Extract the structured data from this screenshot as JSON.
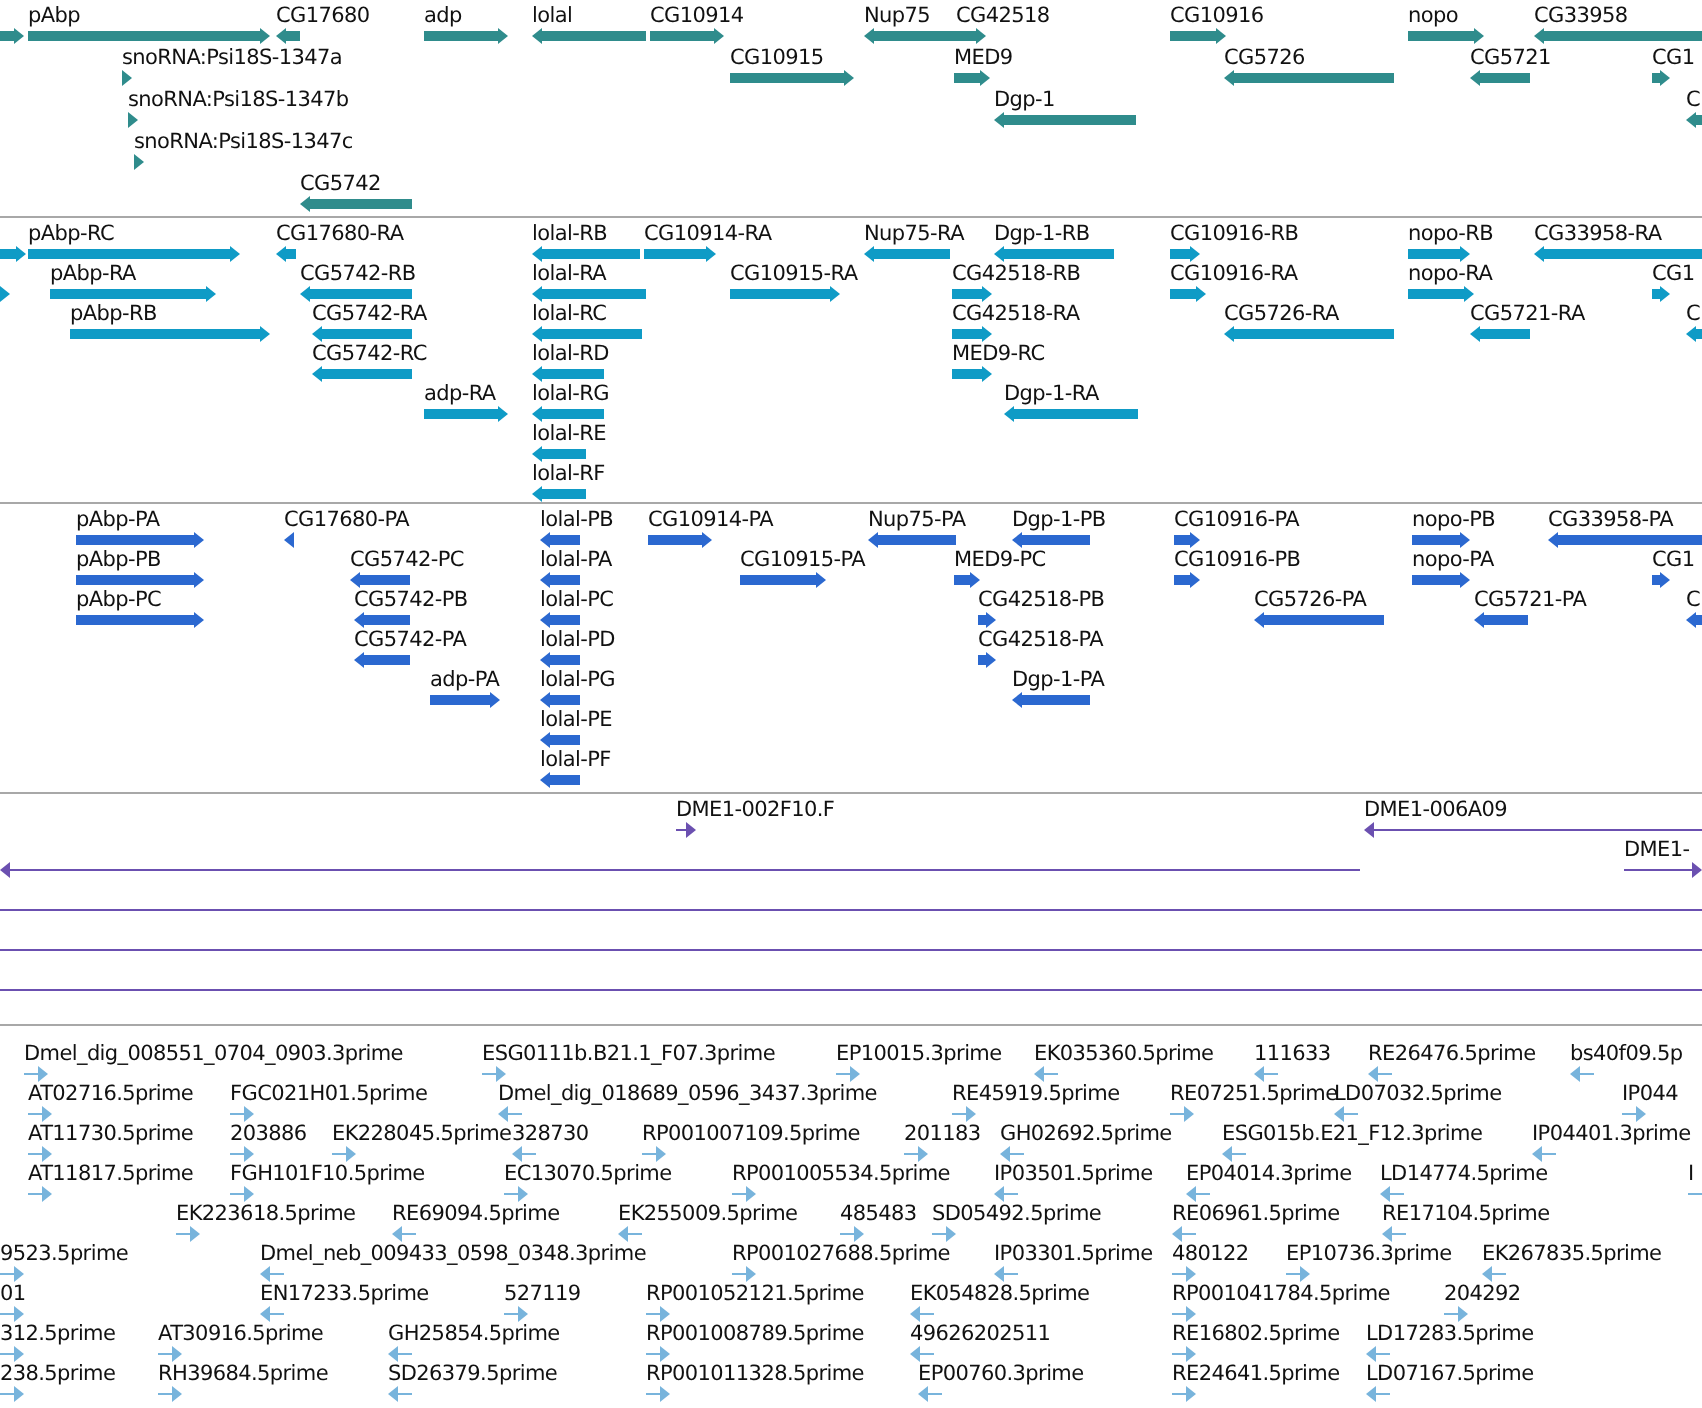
{
  "tracks": [
    {
      "kind": "gene",
      "color": "#2f8c8c",
      "rows": [
        {
          "features": [
            {
              "reverse": false
            },
            {
              "label": "pAbp",
              "reverse": false
            },
            {
              "label": "CG17680",
              "reverse": true
            },
            {
              "label": "adp",
              "reverse": false
            },
            {
              "label": "lolal",
              "reverse": true
            },
            {
              "label": "CG10914",
              "reverse": false
            },
            {
              "label": "Nup75",
              "reverse": true
            },
            {
              "label": "CG42518",
              "reverse": false
            },
            {
              "label": "CG10916",
              "reverse": false
            },
            {
              "label": "nopo",
              "reverse": false
            },
            {
              "label": "CG33958",
              "reverse": true
            }
          ]
        },
        {
          "features": [
            {
              "label": "snoRNA:Psi18S-1347a",
              "reverse": false
            },
            {
              "label": "CG10915",
              "reverse": false
            },
            {
              "label": "MED9",
              "reverse": false
            },
            {
              "label": "CG5726",
              "reverse": true
            },
            {
              "label": "CG5721",
              "reverse": true
            },
            {
              "label": "CG1",
              "reverse": false
            }
          ]
        },
        {
          "features": [
            {
              "label": "snoRNA:Psi18S-1347b",
              "reverse": false
            },
            {
              "label": "Dgp-1",
              "reverse": true
            },
            {
              "label": "C",
              "reverse": true
            }
          ]
        },
        {
          "features": [
            {
              "label": "snoRNA:Psi18S-1347c",
              "reverse": false
            }
          ]
        },
        {
          "features": [
            {
              "label": "CG5742",
              "reverse": true
            }
          ]
        }
      ]
    },
    {
      "kind": "gene",
      "color": "#0f9bc6",
      "rows": [
        {
          "features": [
            {
              "reverse": false
            },
            {
              "label": "pAbp-RC",
              "reverse": false
            },
            {
              "label": "CG17680-RA",
              "reverse": true
            },
            {
              "label": "lolal-RB",
              "reverse": true
            },
            {
              "label": "CG10914-RA",
              "reverse": false
            },
            {
              "label": "Nup75-RA",
              "reverse": true
            },
            {
              "label": "Dgp-1-RB",
              "reverse": true
            },
            {
              "label": "CG10916-RB",
              "reverse": false
            },
            {
              "label": "nopo-RB",
              "reverse": false
            },
            {
              "label": "CG33958-RA",
              "reverse": true
            }
          ]
        },
        {
          "features": [
            {
              "reverse": false
            },
            {
              "label": "pAbp-RA",
              "reverse": false
            },
            {
              "label": "CG5742-RB",
              "reverse": true
            },
            {
              "label": "lolal-RA",
              "reverse": true
            },
            {
              "label": "CG10915-RA",
              "reverse": false
            },
            {
              "label": "CG42518-RB",
              "reverse": false
            },
            {
              "label": "CG10916-RA",
              "reverse": false
            },
            {
              "label": "nopo-RA",
              "reverse": false
            },
            {
              "label": "CG1",
              "reverse": false
            }
          ]
        },
        {
          "features": [
            {
              "label": "pAbp-RB",
              "reverse": false
            },
            {
              "label": "CG5742-RA",
              "reverse": true
            },
            {
              "label": "lolal-RC",
              "reverse": true
            },
            {
              "label": "CG42518-RA",
              "reverse": false
            },
            {
              "label": "CG5726-RA",
              "reverse": true
            },
            {
              "label": "CG5721-RA",
              "reverse": true
            },
            {
              "label": "C",
              "reverse": true
            }
          ]
        },
        {
          "features": [
            {
              "label": "CG5742-RC",
              "reverse": true
            },
            {
              "label": "lolal-RD",
              "reverse": true
            },
            {
              "label": "MED9-RC",
              "reverse": false
            }
          ]
        },
        {
          "features": [
            {
              "label": "adp-RA",
              "reverse": false
            },
            {
              "label": "lolal-RG",
              "reverse": true
            },
            {
              "label": "Dgp-1-RA",
              "reverse": true
            }
          ]
        },
        {
          "features": [
            {
              "label": "lolal-RE",
              "reverse": true
            }
          ]
        },
        {
          "features": [
            {
              "label": "lolal-RF",
              "reverse": true
            }
          ]
        }
      ]
    },
    {
      "kind": "gene",
      "color": "#2b68d0",
      "rows": [
        {
          "features": [
            {
              "label": "pAbp-PA",
              "reverse": false
            },
            {
              "label": "CG17680-PA",
              "reverse": true
            },
            {
              "label": "lolal-PB",
              "reverse": true
            },
            {
              "label": "CG10914-PA",
              "reverse": false
            },
            {
              "label": "Nup75-PA",
              "reverse": true
            },
            {
              "label": "Dgp-1-PB",
              "reverse": true
            },
            {
              "label": "CG10916-PA",
              "reverse": false
            },
            {
              "label": "nopo-PB",
              "reverse": false
            },
            {
              "label": "CG33958-PA",
              "reverse": true
            }
          ]
        },
        {
          "features": [
            {
              "label": "pAbp-PB",
              "reverse": false
            },
            {
              "label": "CG5742-PC",
              "reverse": true
            },
            {
              "label": "lolal-PA",
              "reverse": true
            },
            {
              "label": "CG10915-PA",
              "reverse": false
            },
            {
              "label": "MED9-PC",
              "reverse": false
            },
            {
              "label": "CG10916-PB",
              "reverse": false
            },
            {
              "label": "nopo-PA",
              "reverse": false
            },
            {
              "label": "CG1",
              "reverse": false
            }
          ]
        },
        {
          "features": [
            {
              "label": "pAbp-PC",
              "reverse": false
            },
            {
              "label": "CG5742-PB",
              "reverse": true
            },
            {
              "label": "lolal-PC",
              "reverse": true
            },
            {
              "label": "CG42518-PB",
              "reverse": false
            },
            {
              "label": "CG5726-PA",
              "reverse": true
            },
            {
              "label": "CG5721-PA",
              "reverse": true
            },
            {
              "label": "C",
              "reverse": true
            }
          ]
        },
        {
          "features": [
            {
              "label": "CG5742-PA",
              "reverse": true
            },
            {
              "label": "lolal-PD",
              "reverse": true
            },
            {
              "label": "CG42518-PA",
              "reverse": false
            }
          ]
        },
        {
          "features": [
            {
              "label": "adp-PA",
              "reverse": false
            },
            {
              "label": "lolal-PG",
              "reverse": true
            },
            {
              "label": "Dgp-1-PA",
              "reverse": true
            }
          ]
        },
        {
          "features": [
            {
              "label": "lolal-PE",
              "reverse": true
            }
          ]
        },
        {
          "features": [
            {
              "label": "lolal-PF",
              "reverse": true
            }
          ]
        }
      ]
    },
    {
      "kind": "alignment",
      "color": "#6b50b0",
      "rows": [
        {
          "features": [
            {
              "label": "DME1-002F10.F",
              "reverse": false
            },
            {
              "label": "DME1-006A09",
              "reverse": true
            }
          ]
        },
        {
          "features": [
            {
              "reverse": true
            },
            {
              "label": "DME1-",
              "reverse": false
            }
          ]
        },
        {
          "features": [
            {
              "arrowhead": false
            }
          ]
        },
        {
          "features": [
            {
              "arrowhead": false
            }
          ]
        },
        {
          "features": [
            {
              "arrowhead": false
            }
          ]
        }
      ]
    },
    {
      "kind": "alignment",
      "color": "#78b4dc",
      "rows": [
        {
          "features": [
            {
              "label": "Dmel_dig_008551_0704_0903.3prime",
              "reverse": false
            },
            {
              "label": "ESG0111b.B21.1_F07.3prime",
              "reverse": false
            },
            {
              "label": "EP10015.3prime",
              "reverse": false
            },
            {
              "label": "EK035360.5prime",
              "reverse": true
            },
            {
              "label": "111633",
              "reverse": true
            },
            {
              "label": "RE26476.5prime",
              "reverse": true
            },
            {
              "label": "bs40f09.5p",
              "reverse": true
            }
          ]
        },
        {
          "features": [
            {
              "label": "AT02716.5prime",
              "reverse": false
            },
            {
              "label": "FGC021H01.5prime",
              "reverse": false
            },
            {
              "label": "Dmel_dig_018689_0596_3437.3prime",
              "reverse": true
            },
            {
              "label": "RE45919.5prime",
              "reverse": false
            },
            {
              "label": "RE07251.5prime",
              "reverse": false
            },
            {
              "label": "LD07032.5prime",
              "reverse": true
            },
            {
              "label": "IP044",
              "reverse": false
            }
          ]
        },
        {
          "features": [
            {
              "label": "AT11730.5prime",
              "reverse": false
            },
            {
              "label": "203886",
              "reverse": false
            },
            {
              "label": "EK228045.5prime",
              "reverse": false
            },
            {
              "label": "328730",
              "reverse": true
            },
            {
              "label": "RP001007109.5prime",
              "reverse": false
            },
            {
              "label": "201183",
              "reverse": false
            },
            {
              "label": "GH02692.5prime",
              "reverse": true
            },
            {
              "label": "ESG015b.E21_F12.3prime",
              "reverse": true
            },
            {
              "label": "IP04401.3prime",
              "reverse": true
            }
          ]
        },
        {
          "features": [
            {
              "label": "AT11817.5prime",
              "reverse": false
            },
            {
              "label": "FGH101F10.5prime",
              "reverse": false
            },
            {
              "label": "EC13070.5prime",
              "reverse": false
            },
            {
              "label": "RP001005534.5prime",
              "reverse": false
            },
            {
              "label": "IP03501.5prime",
              "reverse": true
            },
            {
              "label": "EP04014.3prime",
              "reverse": true
            },
            {
              "label": "LD14774.5prime",
              "reverse": true
            },
            {
              "label": "I",
              "reverse": false
            }
          ]
        },
        {
          "features": [
            {
              "label": "EK223618.5prime",
              "reverse": false
            },
            {
              "label": "RE69094.5prime",
              "reverse": true
            },
            {
              "label": "EK255009.5prime",
              "reverse": true
            },
            {
              "label": "485483",
              "reverse": false
            },
            {
              "label": "SD05492.5prime",
              "reverse": false
            },
            {
              "label": "RE06961.5prime",
              "reverse": true
            },
            {
              "label": "RE17104.5prime",
              "reverse": true
            }
          ]
        },
        {
          "features": [
            {
              "label": "9523.5prime",
              "reverse": false
            },
            {
              "label": "Dmel_neb_009433_0598_0348.3prime",
              "reverse": true
            },
            {
              "label": "RP001027688.5prime",
              "reverse": false
            },
            {
              "label": "IP03301.5prime",
              "reverse": true
            },
            {
              "label": "480122",
              "reverse": false
            },
            {
              "label": "EP10736.3prime",
              "reverse": false
            },
            {
              "label": "EK267835.5prime",
              "reverse": true
            }
          ]
        },
        {
          "features": [
            {
              "label": "01",
              "reverse": false
            },
            {
              "label": "EN17233.5prime",
              "reverse": true
            },
            {
              "label": "527119",
              "reverse": false
            },
            {
              "label": "RP001052121.5prime",
              "reverse": false
            },
            {
              "label": "EK054828.5prime",
              "reverse": true
            },
            {
              "label": "RP001041784.5prime",
              "reverse": false
            },
            {
              "label": "204292",
              "reverse": false
            }
          ]
        },
        {
          "features": [
            {
              "label": "312.5prime",
              "reverse": false
            },
            {
              "label": "AT30916.5prime",
              "reverse": false
            },
            {
              "label": "GH25854.5prime",
              "reverse": true
            },
            {
              "label": "RP001008789.5prime",
              "reverse": false
            },
            {
              "label": "49626202511",
              "reverse": true
            },
            {
              "label": "RE16802.5prime",
              "reverse": false
            },
            {
              "label": "LD17283.5prime",
              "reverse": true
            }
          ]
        },
        {
          "features": [
            {
              "label": "238.5prime",
              "reverse": false
            },
            {
              "label": "RH39684.5prime",
              "reverse": false
            },
            {
              "label": "SD26379.5prime",
              "reverse": true
            },
            {
              "label": "RP001011328.5prime",
              "reverse": false
            },
            {
              "label": "EP00760.3prime",
              "reverse": true
            },
            {
              "label": "RE24641.5prime",
              "reverse": false
            },
            {
              "label": "LD07167.5prime",
              "reverse": true
            }
          ]
        }
      ]
    }
  ]
}
